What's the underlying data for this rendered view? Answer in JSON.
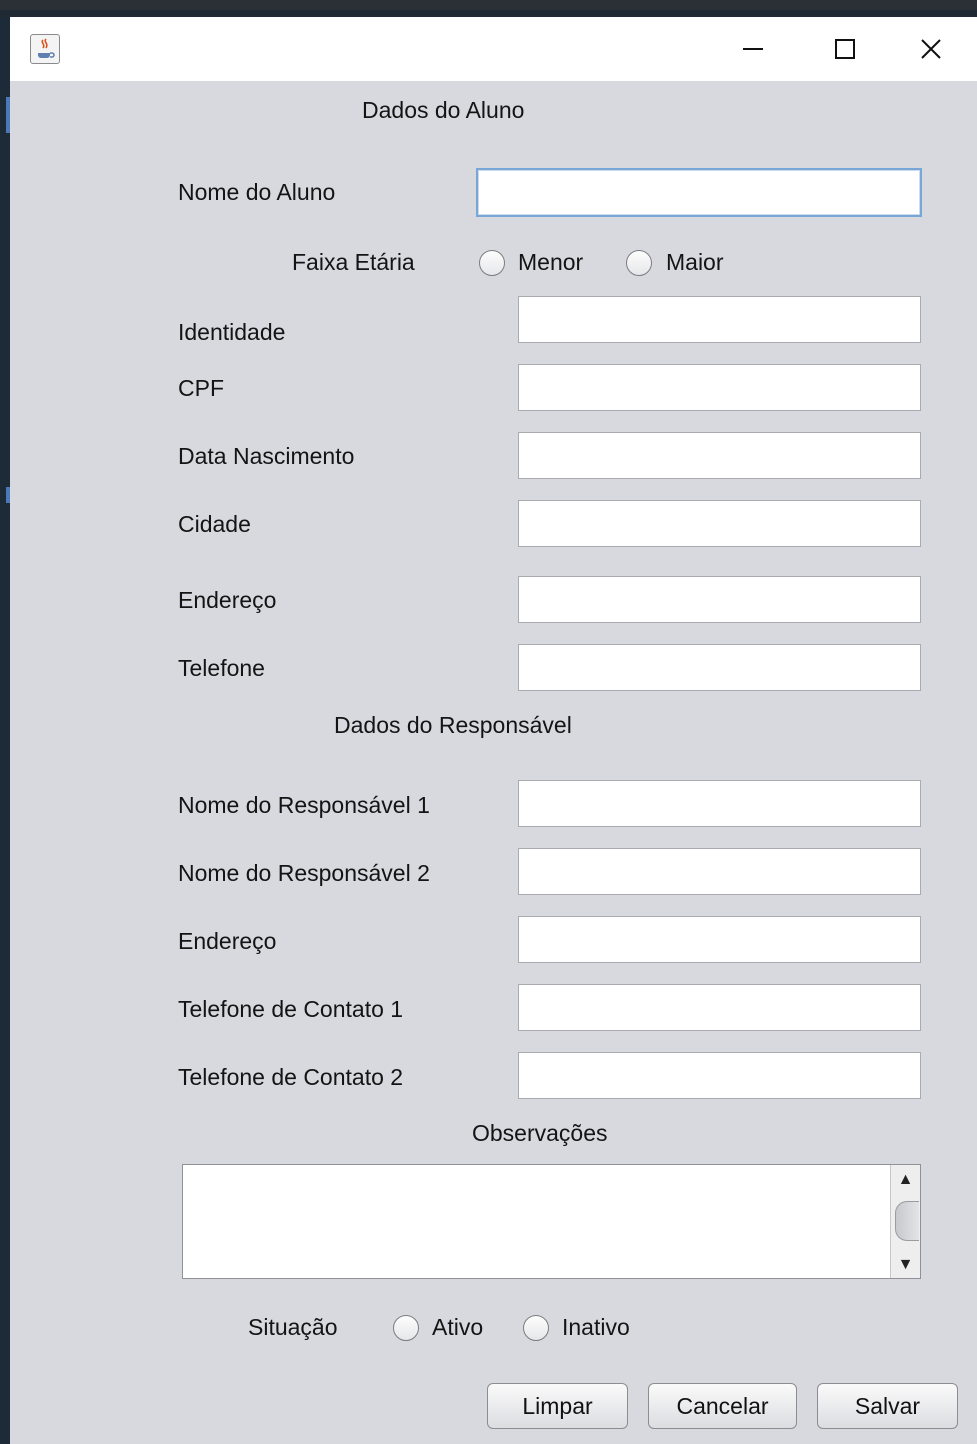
{
  "window": {
    "title_icon": "java-coffee-icon",
    "buttons": {
      "minimize": "minimize-icon",
      "maximize": "maximize-icon",
      "close": "close-icon"
    }
  },
  "sections": {
    "student_title": "Dados do Aluno",
    "guardian_title": "Dados do Responsável",
    "notes_title": "Observações"
  },
  "student": {
    "name_label": "Nome do Aluno",
    "name_value": "",
    "age_group_label": "Faixa Etária",
    "age_options": [
      "Menor",
      "Maior"
    ],
    "identity_label": "Identidade",
    "cpf_label": "CPF",
    "birth_label": "Data Nascimento",
    "city_label": "Cidade",
    "address_label": "Endereço",
    "phone_label": "Telefone"
  },
  "guardian": {
    "name1_label": "Nome do Responsável 1",
    "name2_label": "Nome do Responsável 2",
    "address_label": "Endereço",
    "contact1_label": "Telefone de Contato 1",
    "contact2_label": "Telefone de Contato 2"
  },
  "status": {
    "label": "Situação",
    "options": [
      "Ativo",
      "Inativo"
    ]
  },
  "actions": {
    "clear": "Limpar",
    "cancel": "Cancelar",
    "save": "Salvar"
  },
  "colors": {
    "window_bg": "#d7d9df",
    "field_bg": "#ffffff",
    "focus_border": "#7aa6d6"
  }
}
